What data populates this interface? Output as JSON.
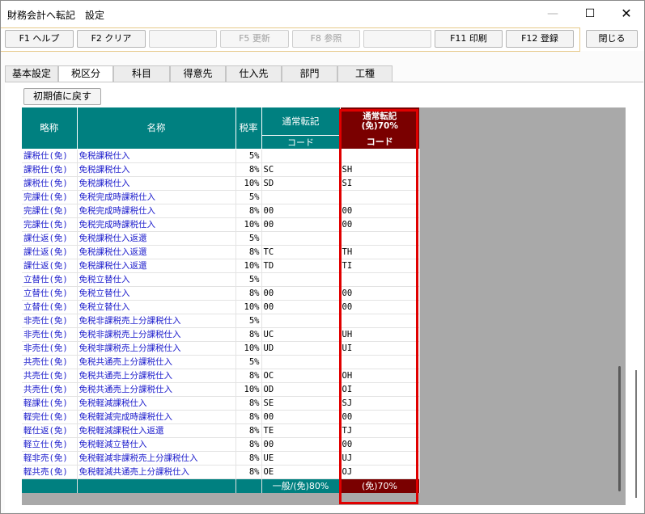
{
  "window": {
    "title": "財務会計へ転記　設定",
    "min_glyph": "—",
    "max_glyph": "☐",
    "close_glyph": "✕"
  },
  "fkeys": {
    "f1": "F1 ヘルプ",
    "f2": "F2 クリア",
    "f5": "F5 更新",
    "f8": "F8 参照",
    "f11": "F11 印刷",
    "f12": "F12 登録",
    "close": "閉じる"
  },
  "tabs": [
    "基本設定",
    "税区分",
    "科目",
    "得意先",
    "仕入先",
    "部門",
    "工種"
  ],
  "reset_button": "初期値に戻す",
  "grid": {
    "headers": {
      "abbr": "略称",
      "name": "名称",
      "rate": "税率",
      "normal": "通常転記",
      "normal_code": "コード",
      "exempt_line1": "通常転記",
      "exempt_line2": "(免)70%",
      "exempt_code": "コード"
    },
    "rows": [
      {
        "abbr": "課税仕(免)",
        "name": "免税課税仕入",
        "rate": "5%",
        "code": "",
        "code2": ""
      },
      {
        "abbr": "課税仕(免)",
        "name": "免税課税仕入",
        "rate": "8%",
        "code": "SC",
        "code2": "SH"
      },
      {
        "abbr": "課税仕(免)",
        "name": "免税課税仕入",
        "rate": "10%",
        "code": "SD",
        "code2": "SI"
      },
      {
        "abbr": "完課仕(免)",
        "name": "免税完成時課税仕入",
        "rate": "5%",
        "code": "",
        "code2": ""
      },
      {
        "abbr": "完課仕(免)",
        "name": "免税完成時課税仕入",
        "rate": "8%",
        "code": "00",
        "code2": "00"
      },
      {
        "abbr": "完課仕(免)",
        "name": "免税完成時課税仕入",
        "rate": "10%",
        "code": "00",
        "code2": "00"
      },
      {
        "abbr": "課仕返(免)",
        "name": "免税課税仕入返還",
        "rate": "5%",
        "code": "",
        "code2": ""
      },
      {
        "abbr": "課仕返(免)",
        "name": "免税課税仕入返還",
        "rate": "8%",
        "code": "TC",
        "code2": "TH"
      },
      {
        "abbr": "課仕返(免)",
        "name": "免税課税仕入返還",
        "rate": "10%",
        "code": "TD",
        "code2": "TI"
      },
      {
        "abbr": "立替仕(免)",
        "name": "免税立替仕入",
        "rate": "5%",
        "code": "",
        "code2": ""
      },
      {
        "abbr": "立替仕(免)",
        "name": "免税立替仕入",
        "rate": "8%",
        "code": "00",
        "code2": "00"
      },
      {
        "abbr": "立替仕(免)",
        "name": "免税立替仕入",
        "rate": "10%",
        "code": "00",
        "code2": "00"
      },
      {
        "abbr": "非売仕(免)",
        "name": "免税非課税売上分課税仕入",
        "rate": "5%",
        "code": "",
        "code2": ""
      },
      {
        "abbr": "非売仕(免)",
        "name": "免税非課税売上分課税仕入",
        "rate": "8%",
        "code": "UC",
        "code2": "UH"
      },
      {
        "abbr": "非売仕(免)",
        "name": "免税非課税売上分課税仕入",
        "rate": "10%",
        "code": "UD",
        "code2": "UI"
      },
      {
        "abbr": "共売仕(免)",
        "name": "免税共通売上分課税仕入",
        "rate": "5%",
        "code": "",
        "code2": ""
      },
      {
        "abbr": "共売仕(免)",
        "name": "免税共通売上分課税仕入",
        "rate": "8%",
        "code": "OC",
        "code2": "OH"
      },
      {
        "abbr": "共売仕(免)",
        "name": "免税共通売上分課税仕入",
        "rate": "10%",
        "code": "OD",
        "code2": "OI"
      },
      {
        "abbr": "軽課仕(免)",
        "name": "免税軽減課税仕入",
        "rate": "8%",
        "code": "SE",
        "code2": "SJ"
      },
      {
        "abbr": "軽完仕(免)",
        "name": "免税軽減完成時課税仕入",
        "rate": "8%",
        "code": "00",
        "code2": "00"
      },
      {
        "abbr": "軽仕返(免)",
        "name": "免税軽減課税仕入返還",
        "rate": "8%",
        "code": "TE",
        "code2": "TJ"
      },
      {
        "abbr": "軽立仕(免)",
        "name": "免税軽減立替仕入",
        "rate": "8%",
        "code": "00",
        "code2": "00"
      },
      {
        "abbr": "軽非売(免)",
        "name": "免税軽減非課税売上分課税仕入",
        "rate": "8%",
        "code": "UE",
        "code2": "UJ"
      },
      {
        "abbr": "軽共売(免)",
        "name": "免税軽減共通売上分課税仕入",
        "rate": "8%",
        "code": "OE",
        "code2": "OJ"
      }
    ],
    "footer": {
      "normal": "一般/(免)80%",
      "exempt": "(免)70%"
    }
  },
  "colors": {
    "header_teal": "#008080",
    "header_exempt": "#7a0000",
    "highlight_frame": "#e00000",
    "abbr_text": "#1c1ccc"
  }
}
